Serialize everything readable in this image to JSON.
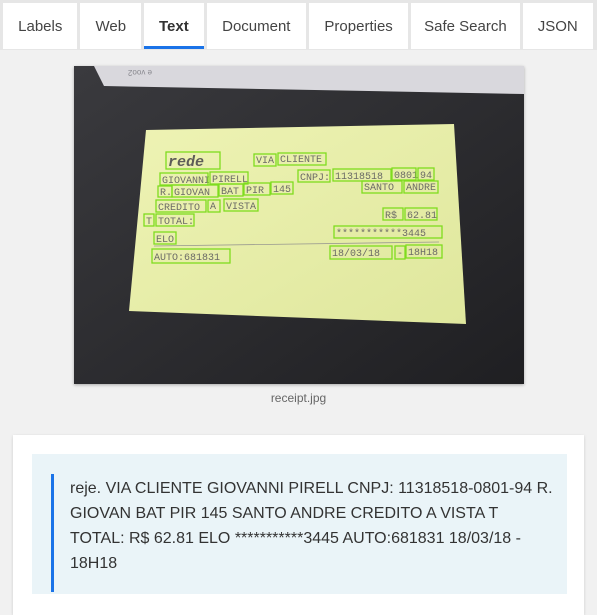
{
  "tabs": [
    {
      "label": "Labels"
    },
    {
      "label": "Web"
    },
    {
      "label": "Text",
      "active": true
    },
    {
      "label": "Document"
    },
    {
      "label": "Properties"
    },
    {
      "label": "Safe Search"
    },
    {
      "label": "JSON"
    }
  ],
  "image": {
    "filename": "receipt.jpg",
    "receipt_words": {
      "w1": "rede",
      "w2": "VIA",
      "w3": "CLIENTE",
      "w4": "GIOVANNI",
      "w5": "PIRELL",
      "w6": "CNPJ:",
      "w7": "11318518",
      "w8": "0801",
      "w9": "94",
      "w10": "R.",
      "w11": "GIOVAN",
      "w12": "BAT",
      "w13": "PIR",
      "w14": "145",
      "w15": "SANTO",
      "w16": "ANDRE",
      "w17": "CREDITO",
      "w18": "A",
      "w19": "VISTA",
      "w20": "T",
      "w21": "TOTAL:",
      "w22": "R$",
      "w23": "62.81",
      "w24": "ELO",
      "w25": "***********3445",
      "w26": "AUTO:681831",
      "w27": "18/03/18",
      "w28": "-",
      "w29": "18H18"
    },
    "accent_box_color": "#7fdc1e"
  },
  "result": {
    "text": "reje. VIA CLIENTE GIOVANNI PIRELL CNPJ: 11318518-0801-94 R. GIOVAN BAT PIR 145 SANTO ANDRE CREDITO A VISTA T TOTAL: R$ 62.81 ELO ***********3445 AUTO:681831 18/03/18 - 18H18"
  },
  "colors": {
    "accent": "#1a73e8",
    "result_bg": "#eaf4f8"
  }
}
